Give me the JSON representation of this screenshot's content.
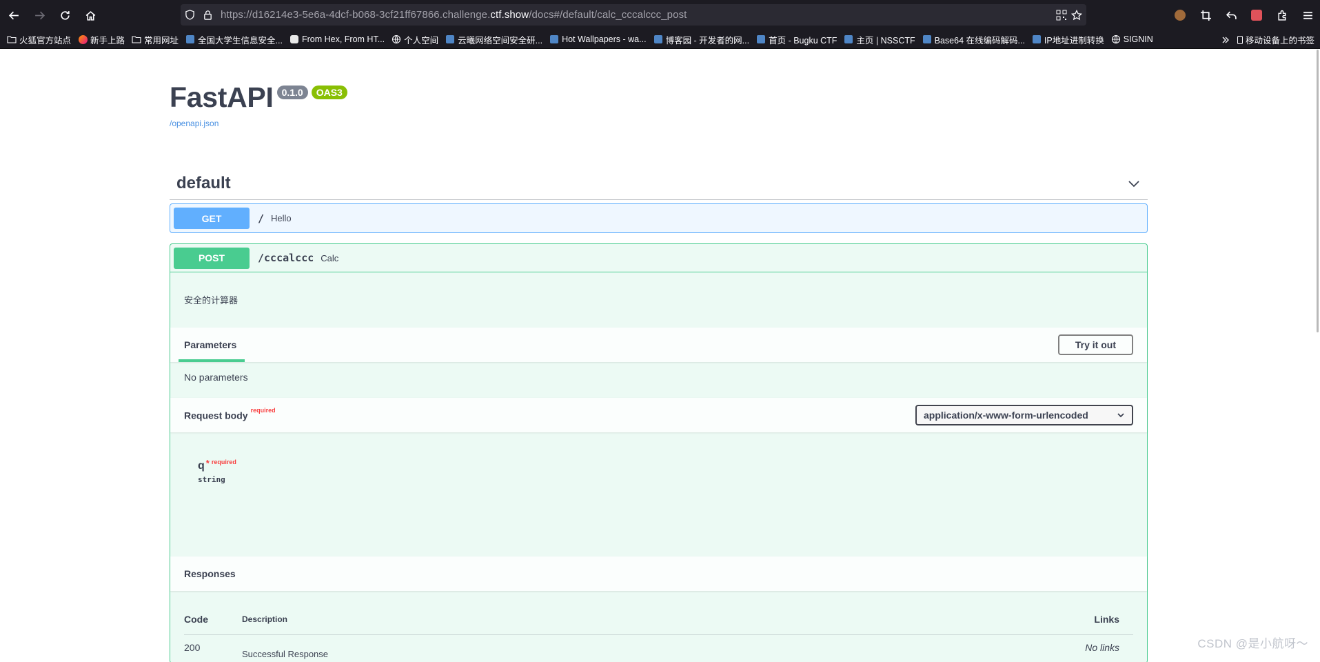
{
  "browser": {
    "url_prefix": "https://d16214e3-5e6a-4dcf-b068-3cf21ff67866.challenge.",
    "url_domain": "ctf.show",
    "url_suffix": "/docs#/default/calc_cccalccc_post",
    "bookmarks": [
      {
        "label": "火狐官方站点",
        "icon": "folder-icon"
      },
      {
        "label": "新手上路",
        "icon": "firefox-icon"
      },
      {
        "label": "常用网址",
        "icon": "folder-icon"
      },
      {
        "label": "全国大学生信息安全...",
        "icon": "site-icon"
      },
      {
        "label": "From Hex, From HT...",
        "icon": "chef-icon"
      },
      {
        "label": "个人空间",
        "icon": "globe-icon"
      },
      {
        "label": "云曦网络空间安全研...",
        "icon": "site-icon"
      },
      {
        "label": "Hot Wallpapers - wa...",
        "icon": "site-icon"
      },
      {
        "label": "博客园 - 开发者的网...",
        "icon": "site-icon"
      },
      {
        "label": "首页 - Bugku CTF",
        "icon": "site-icon"
      },
      {
        "label": "主页 | NSSCTF",
        "icon": "site-icon"
      },
      {
        "label": "Base64 在线编码解码...",
        "icon": "site-icon"
      },
      {
        "label": "IP地址进制转换",
        "icon": "site-icon"
      },
      {
        "label": "SIGNIN",
        "icon": "globe-icon"
      }
    ],
    "mobile_bookmarks": "移动设备上的书签"
  },
  "swagger": {
    "title": "FastAPI",
    "version": "0.1.0",
    "oas": "OAS3",
    "spec_link": "/openapi.json",
    "tag": "default",
    "get_op": {
      "method": "GET",
      "path": "/",
      "summary": "Hello"
    },
    "post_op": {
      "method": "POST",
      "path": "/cccalccc",
      "summary": "Calc",
      "description": "安全的计算器",
      "parameters_title": "Parameters",
      "try_label": "Try it out",
      "no_params": "No parameters",
      "request_body": "Request body",
      "required": "required",
      "content_type": "application/x-www-form-urlencoded",
      "param_name": "q",
      "param_star": "*",
      "param_type": "string",
      "responses_title": "Responses",
      "col_code": "Code",
      "col_desc": "Description",
      "col_links": "Links",
      "row_code": "200",
      "row_desc": "Successful Response",
      "row_links": "No links"
    }
  },
  "watermark": "CSDN @是小航呀～"
}
